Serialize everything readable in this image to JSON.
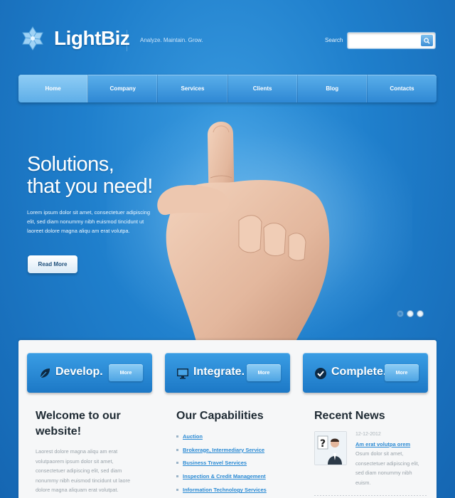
{
  "header": {
    "brand": "LightBiz",
    "tagline": "Analyze. Maintain. Grow.",
    "search_label": "Search",
    "search_value": ""
  },
  "nav": {
    "items": [
      "Home",
      "Company",
      "Services",
      "Clients",
      "Blog",
      "Contacts"
    ],
    "active": "Home"
  },
  "hero": {
    "title_line1": "Solutions,",
    "title_line2": "that you need!",
    "text": "Lorem ipsum dolor sit amet, consectetuer adipiscing elit, sed diam nonummy nibh euismod tincidunt ut laoreet dolore magna aliqu am erat volutpa.",
    "button": "Read More",
    "slides": 3,
    "active_slide": 1
  },
  "features": [
    {
      "title": "Develop.",
      "button": "More",
      "icon": "leaf-icon"
    },
    {
      "title": "Integrate.",
      "button": "More",
      "icon": "monitor-icon"
    },
    {
      "title": "Complete.",
      "button": "More",
      "icon": "checkmark-icon"
    }
  ],
  "welcome": {
    "heading_line1": "Welcome to our",
    "heading_line2": "website!",
    "text": "Laorest dolore magna aliqu am erat volutpaorem ipsum dolor sit amet, consectetuer adipiscing elit, sed diam nonummy nibh euismod tincidunt ut laore dolore magna aliquam erat volutpat."
  },
  "capabilities": {
    "heading": "Our Capabilities",
    "items": [
      "Auction",
      "Brokerage, Intermediary Service",
      "Business Travel Services",
      "Inspection & Credit Management",
      "Information Technology Services"
    ]
  },
  "news": {
    "heading": "Recent News",
    "date": "12-12-2012",
    "link": "Am erat volutpa orem",
    "text": "Osum dolor sit amet, consectetuer adipiscing elit, sed diam nonummy nibh euism."
  },
  "colors": {
    "background": "#1f7fcc",
    "nav": "#2e88d4",
    "link": "#2a8ad4",
    "panel": "#f6f7f8"
  }
}
